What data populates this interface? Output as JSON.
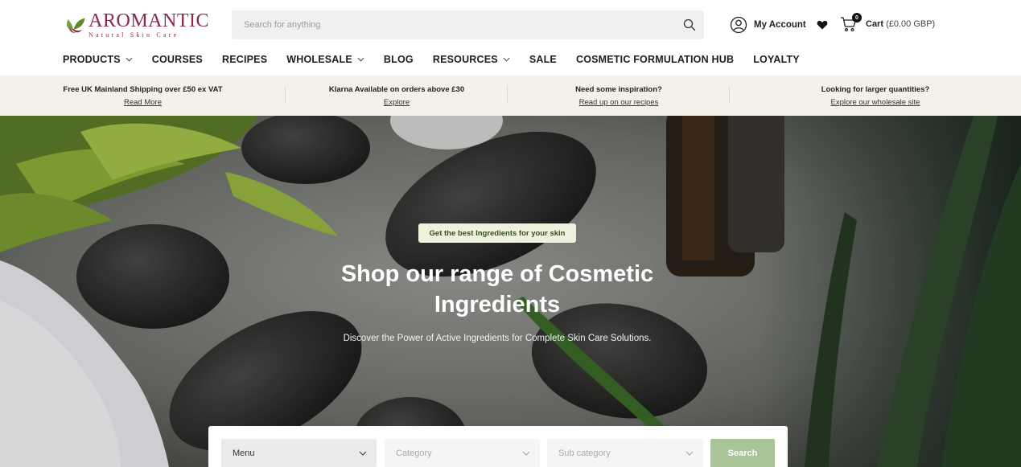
{
  "header": {
    "logo": {
      "name": "AROMANTIC",
      "tagline": "Natural Skin Care"
    },
    "search": {
      "placeholder": "Search for anything",
      "icon": "search-icon"
    },
    "account": {
      "label": "My Account",
      "icon": "user-circle-icon"
    },
    "wishlist": {
      "icon": "heart-icon"
    },
    "cart": {
      "icon": "cart-icon",
      "count": "0",
      "label": "Cart",
      "total": "(£0.00 GBP)"
    }
  },
  "nav": {
    "items": [
      {
        "label": "PRODUCTS",
        "dropdown": true
      },
      {
        "label": "COURSES",
        "dropdown": false
      },
      {
        "label": "RECIPES",
        "dropdown": false
      },
      {
        "label": "WHOLESALE",
        "dropdown": true
      },
      {
        "label": "BLOG",
        "dropdown": false
      },
      {
        "label": "RESOURCES",
        "dropdown": true
      },
      {
        "label": "SALE",
        "dropdown": false
      },
      {
        "label": "COSMETIC FORMULATION HUB",
        "dropdown": false
      },
      {
        "label": "LOYALTY",
        "dropdown": false
      }
    ]
  },
  "info_strip": [
    {
      "title": "Free UK Mainland Shipping over £50 ex VAT",
      "link": "Read More"
    },
    {
      "title": "Klarna Available on orders above £30",
      "link": "Explore"
    },
    {
      "title": "Need some inspiration?",
      "link": "Read up on our recipes"
    },
    {
      "title": "Looking for larger quantities?",
      "link": "Explore our wholesale site"
    }
  ],
  "hero": {
    "badge": "Get the best Ingredients for your skin",
    "title": "Shop our range of Cosmetic Ingredients",
    "subtitle": "Discover the Power of Active Ingredients for Complete Skin Care Solutions."
  },
  "filter": {
    "menu": "Menu",
    "category": "Category",
    "sub_category": "Sub category",
    "button": "Search"
  },
  "colors": {
    "brand": "#8b2a45",
    "info_strip_bg": "#f5f0ea",
    "badge_bg": "#eef2dc",
    "search_button": "#aac49a"
  }
}
